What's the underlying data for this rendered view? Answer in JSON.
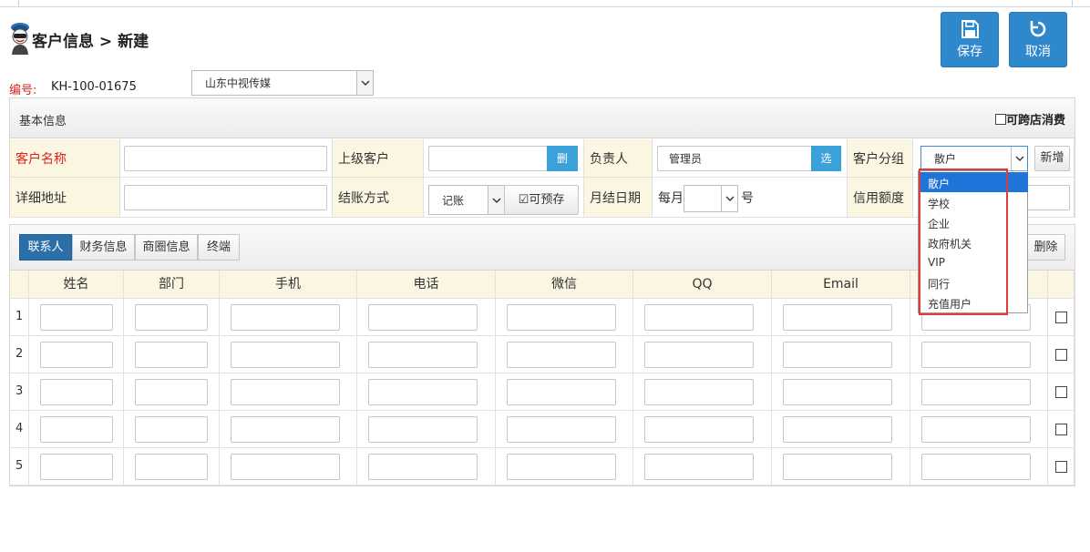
{
  "header": {
    "title": "客户信息 > 新建",
    "save_label": "保存",
    "cancel_label": "取消"
  },
  "record": {
    "id_label": "编号:",
    "id_value": "KH-100-01675",
    "store_value": "山东中视传媒"
  },
  "basic": {
    "section_title": "基本信息",
    "cross_store_label": "可跨店消费",
    "customer_name_label": "客户名称",
    "parent_customer_label": "上级客户",
    "delete_label": "删",
    "owner_label": "负责人",
    "owner_value": "管理员",
    "choose_label": "选",
    "group_label": "客户分组",
    "group_value": "散户",
    "add_label": "新增",
    "address_label": "详细地址",
    "settle_label": "结账方式",
    "settle_value": "记账",
    "prestore_label": "可预存",
    "monthly_label": "月结日期",
    "monthly_prefix": "每月",
    "monthly_suffix": "号",
    "credit_label": "信用额度"
  },
  "group_options": [
    "散户",
    "学校",
    "企业",
    "政府机关",
    "VIP",
    "同行",
    "充值用户"
  ],
  "contacts": {
    "tabs": [
      "联系人",
      "财务信息",
      "商圈信息",
      "终端"
    ],
    "delete_label": "删除",
    "columns": [
      "姓名",
      "部门",
      "手机",
      "电话",
      "微信",
      "QQ",
      "Email"
    ],
    "rows": [
      "1",
      "2",
      "3",
      "4",
      "5"
    ]
  },
  "colors": {
    "accent": "#2f87cc",
    "label_bg": "#fbf6e1",
    "required": "#d9251d",
    "highlight_box": "#e03a3a",
    "selected_option": "#1e74d8"
  }
}
